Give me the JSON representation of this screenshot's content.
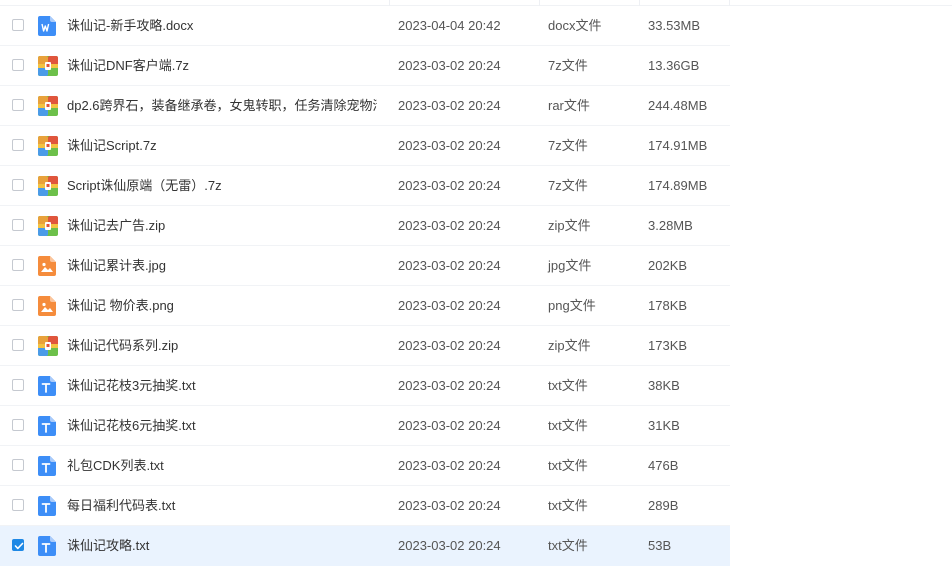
{
  "files": [
    {
      "name": "诛仙记-新手攻略.docx",
      "date": "2023-04-04 20:42",
      "type": "docx文件",
      "size": "33.53MB",
      "icon": "word-doc-icon",
      "checked": false
    },
    {
      "name": "诛仙记DNF客户端.7z",
      "date": "2023-03-02 20:24",
      "type": "7z文件",
      "size": "13.36GB",
      "icon": "archive-icon",
      "checked": false
    },
    {
      "name": "dp2.6跨界石，装备继承卷，女鬼转职，任务清除宠物清...",
      "date": "2023-03-02 20:24",
      "type": "rar文件",
      "size": "244.48MB",
      "icon": "archive-icon",
      "checked": false
    },
    {
      "name": "诛仙记Script.7z",
      "date": "2023-03-02 20:24",
      "type": "7z文件",
      "size": "174.91MB",
      "icon": "archive-icon",
      "checked": false
    },
    {
      "name": "Script诛仙原端（无雷）.7z",
      "date": "2023-03-02 20:24",
      "type": "7z文件",
      "size": "174.89MB",
      "icon": "archive-icon",
      "checked": false
    },
    {
      "name": "诛仙记去广告.zip",
      "date": "2023-03-02 20:24",
      "type": "zip文件",
      "size": "3.28MB",
      "icon": "archive-icon",
      "checked": false
    },
    {
      "name": "诛仙记累计表.jpg",
      "date": "2023-03-02 20:24",
      "type": "jpg文件",
      "size": "202KB",
      "icon": "image-file-icon",
      "checked": false
    },
    {
      "name": "诛仙记  物价表.png",
      "date": "2023-03-02 20:24",
      "type": "png文件",
      "size": "178KB",
      "icon": "image-file-icon",
      "checked": false
    },
    {
      "name": "诛仙记代码系列.zip",
      "date": "2023-03-02 20:24",
      "type": "zip文件",
      "size": "173KB",
      "icon": "archive-icon",
      "checked": false
    },
    {
      "name": "诛仙记花枝3元抽奖.txt",
      "date": "2023-03-02 20:24",
      "type": "txt文件",
      "size": "38KB",
      "icon": "text-file-icon",
      "checked": false
    },
    {
      "name": "诛仙记花枝6元抽奖.txt",
      "date": "2023-03-02 20:24",
      "type": "txt文件",
      "size": "31KB",
      "icon": "text-file-icon",
      "checked": false
    },
    {
      "name": "礼包CDK列表.txt",
      "date": "2023-03-02 20:24",
      "type": "txt文件",
      "size": "476B",
      "icon": "text-file-icon",
      "checked": false
    },
    {
      "name": "每日福利代码表.txt",
      "date": "2023-03-02 20:24",
      "type": "txt文件",
      "size": "289B",
      "icon": "text-file-icon",
      "checked": false
    },
    {
      "name": "诛仙记攻略.txt",
      "date": "2023-03-02 20:24",
      "type": "txt文件",
      "size": "53B",
      "icon": "text-file-icon",
      "checked": true
    }
  ],
  "colors": {
    "selected_row": "#eaf3fe",
    "accent": "#1e88e5",
    "image_icon": "#f58c3c",
    "text_icon": "#3d8ef7",
    "word_icon": "#3d8ef7"
  }
}
